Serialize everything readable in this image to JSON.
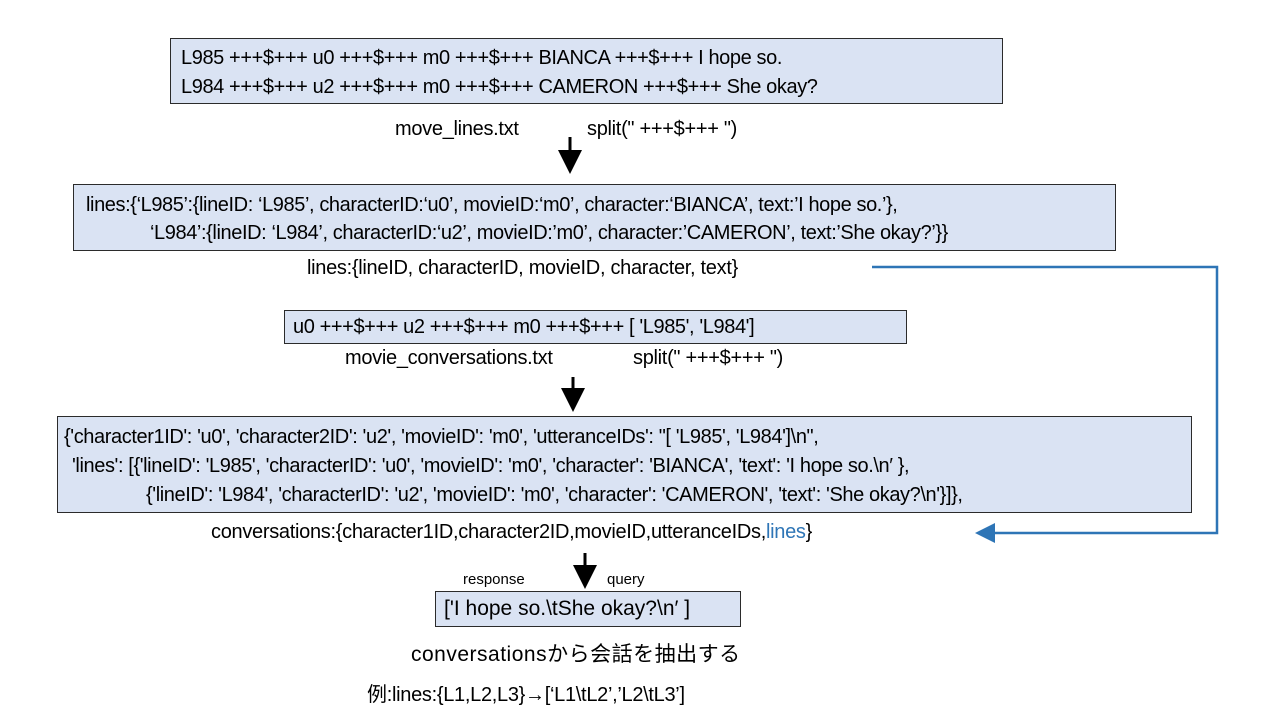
{
  "raw_lines_box": {
    "lines": [
      "L985 +++$+++ u0 +++$+++ m0 +++$+++ BIANCA +++$+++ I hope so.",
      "L984 +++$+++ u2 +++$+++ m0 +++$+++ CAMERON +++$+++ She okay?"
    ]
  },
  "step1": {
    "file": "move_lines.txt",
    "op": "split(\" +++$+++ \")"
  },
  "lines_dict_box": {
    "lines": [
      "lines:{‘L985’:{lineID: ‘L985’, characterID:‘u0’, movieID:‘m0’, character:‘BIANCA’, text:’I hope so.’},",
      "‘L984’:{lineID: ‘L984’, characterID:‘u2’, movieID:’m0’, character:’CAMERON’, text:’She okay?’}}"
    ]
  },
  "lines_schema": "lines:{lineID, characterID, movieID, character, text}",
  "raw_conv_box": {
    "text": "u0 +++$+++ u2 +++$+++ m0 +++$+++ [ 'L985', 'L984']"
  },
  "step2": {
    "file": "movie_conversations.txt",
    "op": "split(\" +++$+++ \")"
  },
  "conv_dict_box": {
    "lines": [
      "{'character1ID': 'u0', 'character2ID': 'u2', 'movieID': 'm0', 'utteranceIDs': \"[ 'L985', 'L984']\\n\",",
      "'lines': [{'lineID': 'L985', 'characterID': 'u0', 'movieID': 'm0', 'character': 'BIANCA', 'text': 'I hope so.\\n′ },",
      "{'lineID': 'L984', 'characterID': 'u2', 'movieID': 'm0', 'character': 'CAMERON', 'text': 'She okay?\\n'}]},"
    ]
  },
  "conv_schema": {
    "prefix": "conversations:{character1ID,character2ID,movieID,utteranceIDs,",
    "highlight": "lines",
    "suffix": "}"
  },
  "step3": {
    "left": "response",
    "right": "query"
  },
  "result_box": {
    "text": "['I hope so.\\tShe okay?\\n′ ]"
  },
  "caption": "conversationsから会話を抽出する",
  "example": "例:lines:{L1,L2,L3}→[‘L1\\tL2’,’L2\\tL3’]",
  "colors": {
    "box_fill": "#dae3f3",
    "connector": "#2e75b6"
  }
}
